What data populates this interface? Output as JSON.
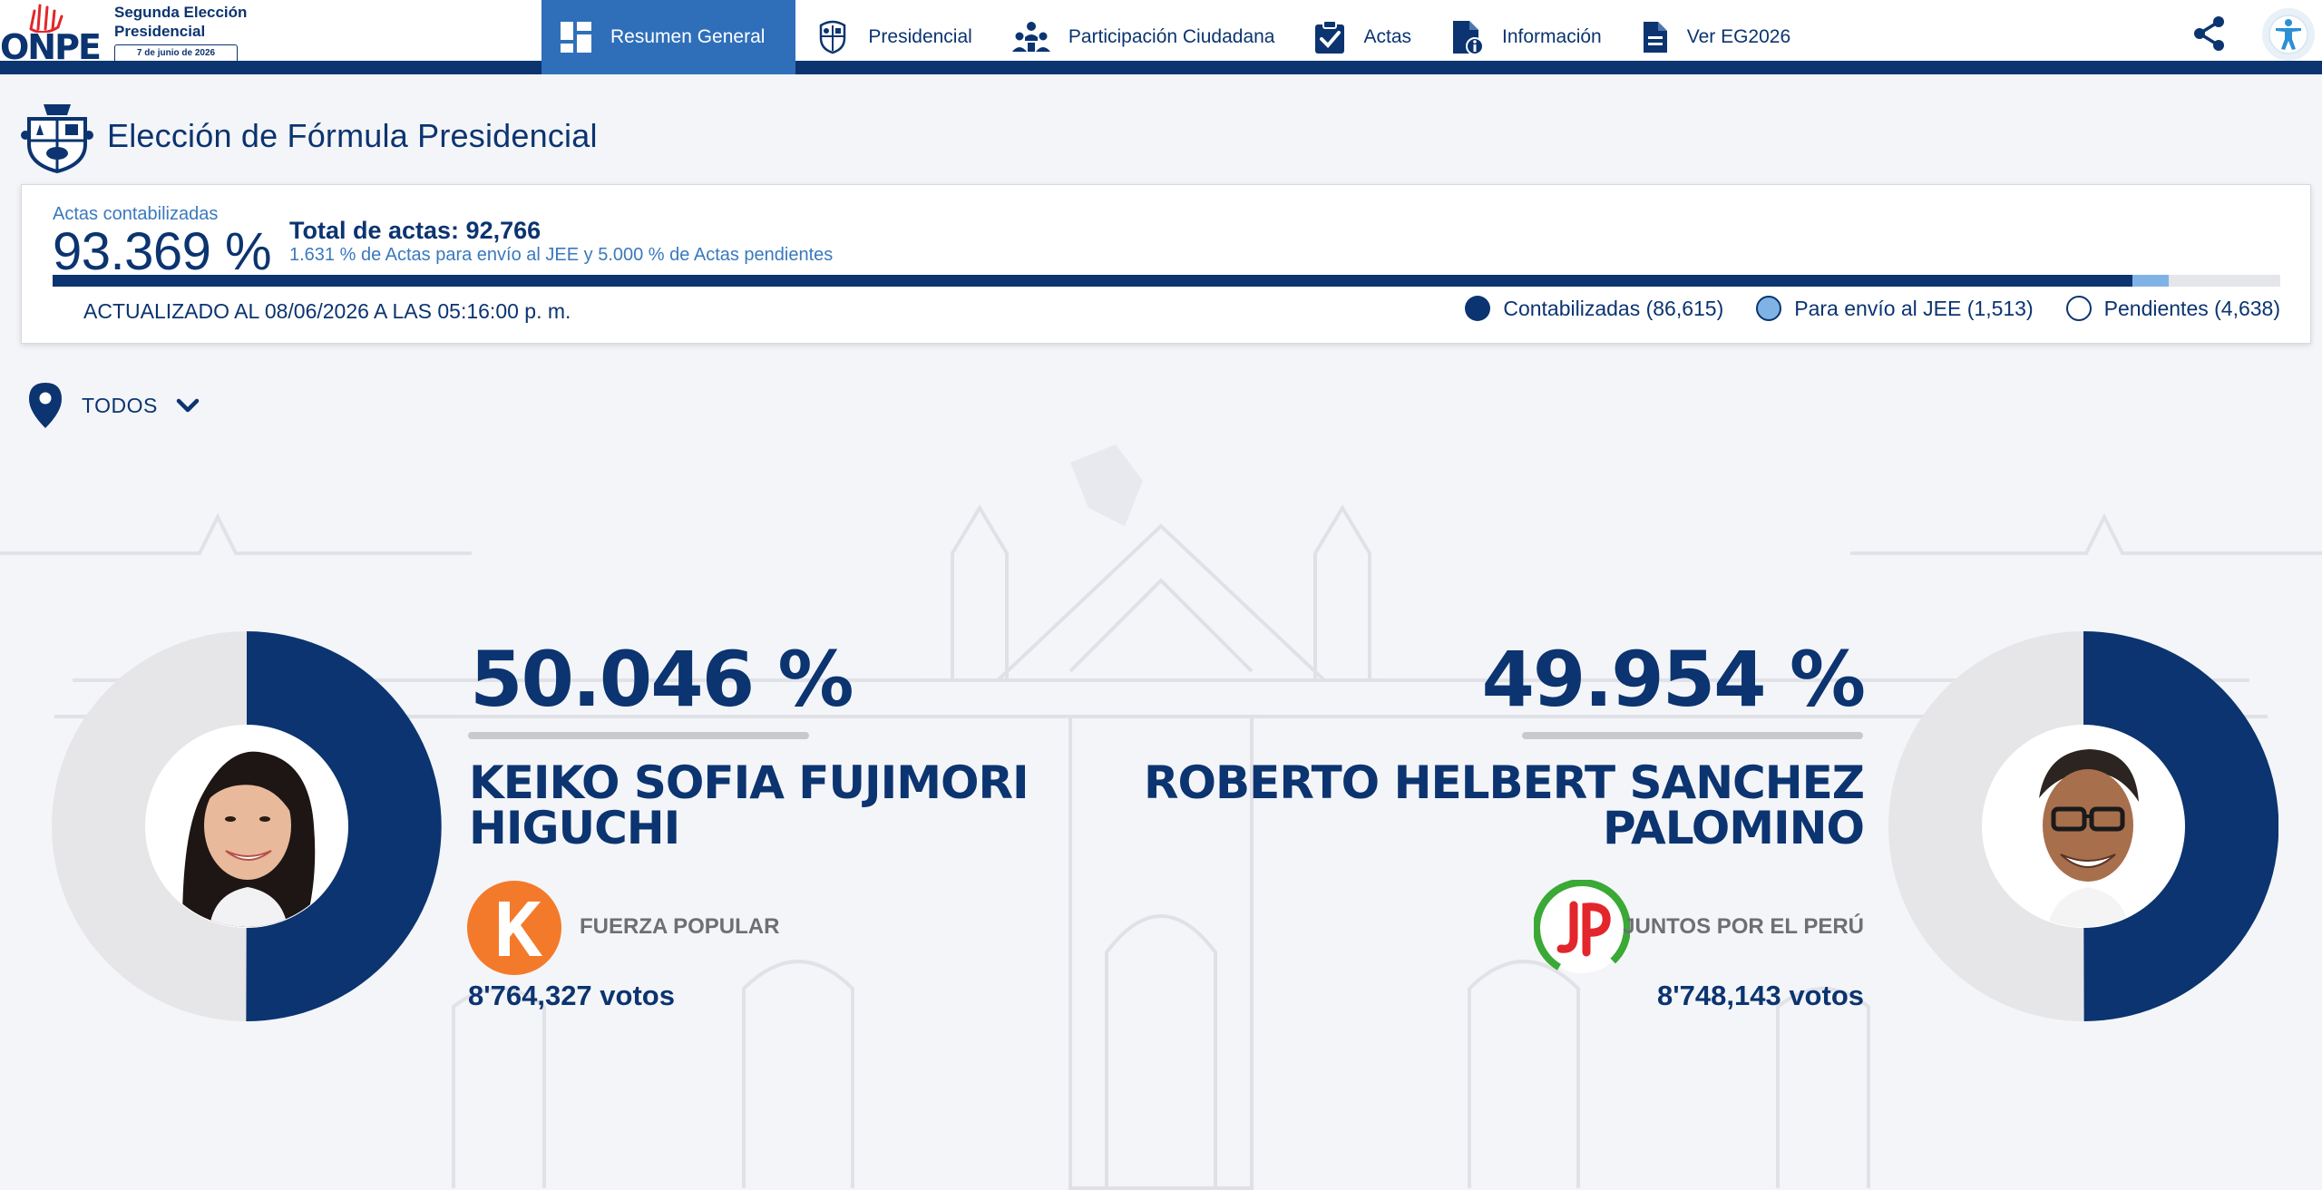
{
  "header": {
    "logo_text": "ONPE",
    "election_title": "Segunda Elección Presidencial",
    "election_date": "7 de junio de 2026",
    "nav": [
      {
        "label": "Resumen General",
        "icon": "dashboard-icon",
        "active": true
      },
      {
        "label": "Presidencial",
        "icon": "coat-of-arms-icon",
        "active": false
      },
      {
        "label": "Participación Ciudadana",
        "icon": "people-icon",
        "active": false
      },
      {
        "label": "Actas",
        "icon": "clipboard-check-icon",
        "active": false
      },
      {
        "label": "Información",
        "icon": "document-info-icon",
        "active": false
      },
      {
        "label": "Ver EG2026",
        "icon": "document-icon",
        "active": false
      }
    ],
    "share_icon": "share-icon",
    "accessibility_icon": "accessibility-icon"
  },
  "page": {
    "title": "Elección de Fórmula Presidencial"
  },
  "progress": {
    "label": "Actas contabilizadas",
    "percent_text": "93.369 %",
    "total_text": "Total de actas: 92,766",
    "subtext": "1.631 % de Actas para envío al JEE y 5.000 % de Actas pendientes",
    "counted_fraction": 0.93369,
    "jee_fraction": 0.01631,
    "updated_text": "ACTUALIZADO AL 08/06/2026 A LAS 05:16:00 p. m.",
    "legend": {
      "counted": "Contabilizadas (86,615)",
      "jee": "Para envío al JEE (1,513)",
      "pending": "Pendientes (4,638)"
    }
  },
  "filter": {
    "label": "TODOS"
  },
  "candidates": [
    {
      "percent_text": "50.046 %",
      "share": 0.50046,
      "name_line1": "KEIKO SOFIA FUJIMORI",
      "name_line2": "HIGUCHI",
      "party": "FUERZA POPULAR",
      "party_logo_text": "K",
      "votes_text": "8'764,327 votos"
    },
    {
      "percent_text": "49.954 %",
      "share": 0.49954,
      "name_line1": "ROBERTO HELBERT SANCHEZ",
      "name_line2": "PALOMINO",
      "party": "JUNTOS POR EL PERÚ",
      "party_logo_text": "JP",
      "votes_text": "8'748,143 votos"
    }
  ],
  "colors": {
    "navy": "#0b3470",
    "accent_blue": "#2f6fba",
    "light_blue": "#7fb3e6",
    "fuerza_popular_orange": "#f47a2b",
    "juntos_green": "#3aa935",
    "juntos_red": "#e2262b"
  }
}
